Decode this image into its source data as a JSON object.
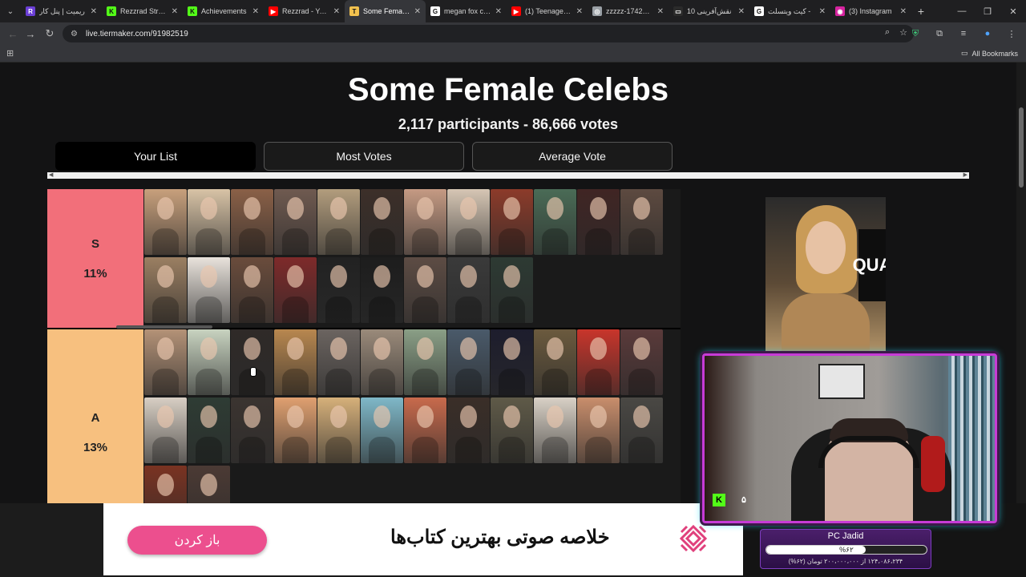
{
  "browser": {
    "tabs": [
      {
        "label": "ریمیت | پنل کار",
        "icon": "remit-icon",
        "color": "#6b3fd6",
        "letter": "R"
      },
      {
        "label": "Rezzrad Stream",
        "icon": "kick-icon",
        "color": "#53fc18",
        "letter": "K"
      },
      {
        "label": "Achievements",
        "icon": "kick-icon",
        "color": "#53fc18",
        "letter": "K"
      },
      {
        "label": "Rezzrad - YouT",
        "icon": "youtube-icon",
        "color": "#ff0000",
        "letter": "▶"
      },
      {
        "label": "Some Female C",
        "icon": "tiermaker-icon",
        "color": "#f2c14e",
        "letter": "T"
      },
      {
        "label": "megan fox cha",
        "icon": "google-icon",
        "color": "#ffffff",
        "letter": "G"
      },
      {
        "label": "(1) Teenage Mi",
        "icon": "youtube-icon",
        "color": "#ff0000",
        "letter": "▶"
      },
      {
        "label": "zzzzz-1742465",
        "icon": "globe-icon",
        "color": "#9aa0a6",
        "letter": "◎"
      },
      {
        "label": "10 نقش‌آفرینی",
        "icon": "media-icon",
        "color": "#2b2b2b",
        "letter": "▭"
      },
      {
        "label": "کیت ویتسلت -",
        "icon": "google-icon",
        "color": "#ffffff",
        "letter": "G"
      },
      {
        "label": "(3) Instagram",
        "icon": "instagram-icon",
        "color": "#d6249f",
        "letter": "◉"
      }
    ],
    "active_tab_index": 4,
    "url": "live.tiermaker.com/91982519",
    "all_bookmarks": "All Bookmarks"
  },
  "page": {
    "title": "Some Female Celebs",
    "subtitle": "2,117 participants - 86,666 votes",
    "view_tabs": [
      "Your List",
      "Most Votes",
      "Average Vote"
    ],
    "selected_view": "Your List"
  },
  "tiers": [
    {
      "name": "S",
      "percent": "11%",
      "color": "#f26f7a",
      "rows": 2,
      "swatches": [
        "#c8a07c",
        "#d8c3a6",
        "#8a6047",
        "#6f5a50",
        "#b29d7d",
        "#3c2f29",
        "#c59a83",
        "#d6c6b4",
        "#8c3b2a",
        "#4a6b56",
        "#402524",
        "#5d4a40",
        "#9b7f62",
        "#e9e3dc",
        "#6a4c3c",
        "#7e2a2a",
        "#222222",
        "#1d1d1d",
        "#5d4c44",
        "#3a3a3a",
        "#2d3a33"
      ]
    },
    {
      "name": "A",
      "percent": "13%",
      "color": "#f7c07f",
      "rows": 3,
      "swatches": [
        "#b49277",
        "#c8d3c0",
        "#2f2a28",
        "#b8874f",
        "#6b6460",
        "#9a8a7a",
        "#8a9f86",
        "#4a5a6a",
        "#1d1d2d",
        "#6b5a3e",
        "#c8352b",
        "#5a3a3a",
        "#d8cfc4",
        "#2e3c34",
        "#3b3430",
        "#e0a070",
        "#d6b07a",
        "#7fb8c8",
        "#c86a4c",
        "#3a2e28",
        "#5f5a48",
        "#d9d1c6",
        "#c98e6c",
        "#4a4844",
        "#7a3322",
        "#4b3a34"
      ]
    }
  ],
  "preview": {
    "wall_text": "QUA"
  },
  "stream": {
    "platform_badge": "K",
    "viewer_count": "۵",
    "donation_name": "PC Jadid",
    "donation_percent": 62,
    "donation_percent_label": "%۶۲",
    "donation_amount": "۱۲۴،۰۸۶،۲۳۴ از ۲۰۰،۰۰۰،۰۰۰ تومان (۶۲%)"
  },
  "ad": {
    "headline": "خلاصه صوتی بهترین کتاب‌ها",
    "button_label": "باز کردن",
    "accent": "#ec4f8e"
  }
}
